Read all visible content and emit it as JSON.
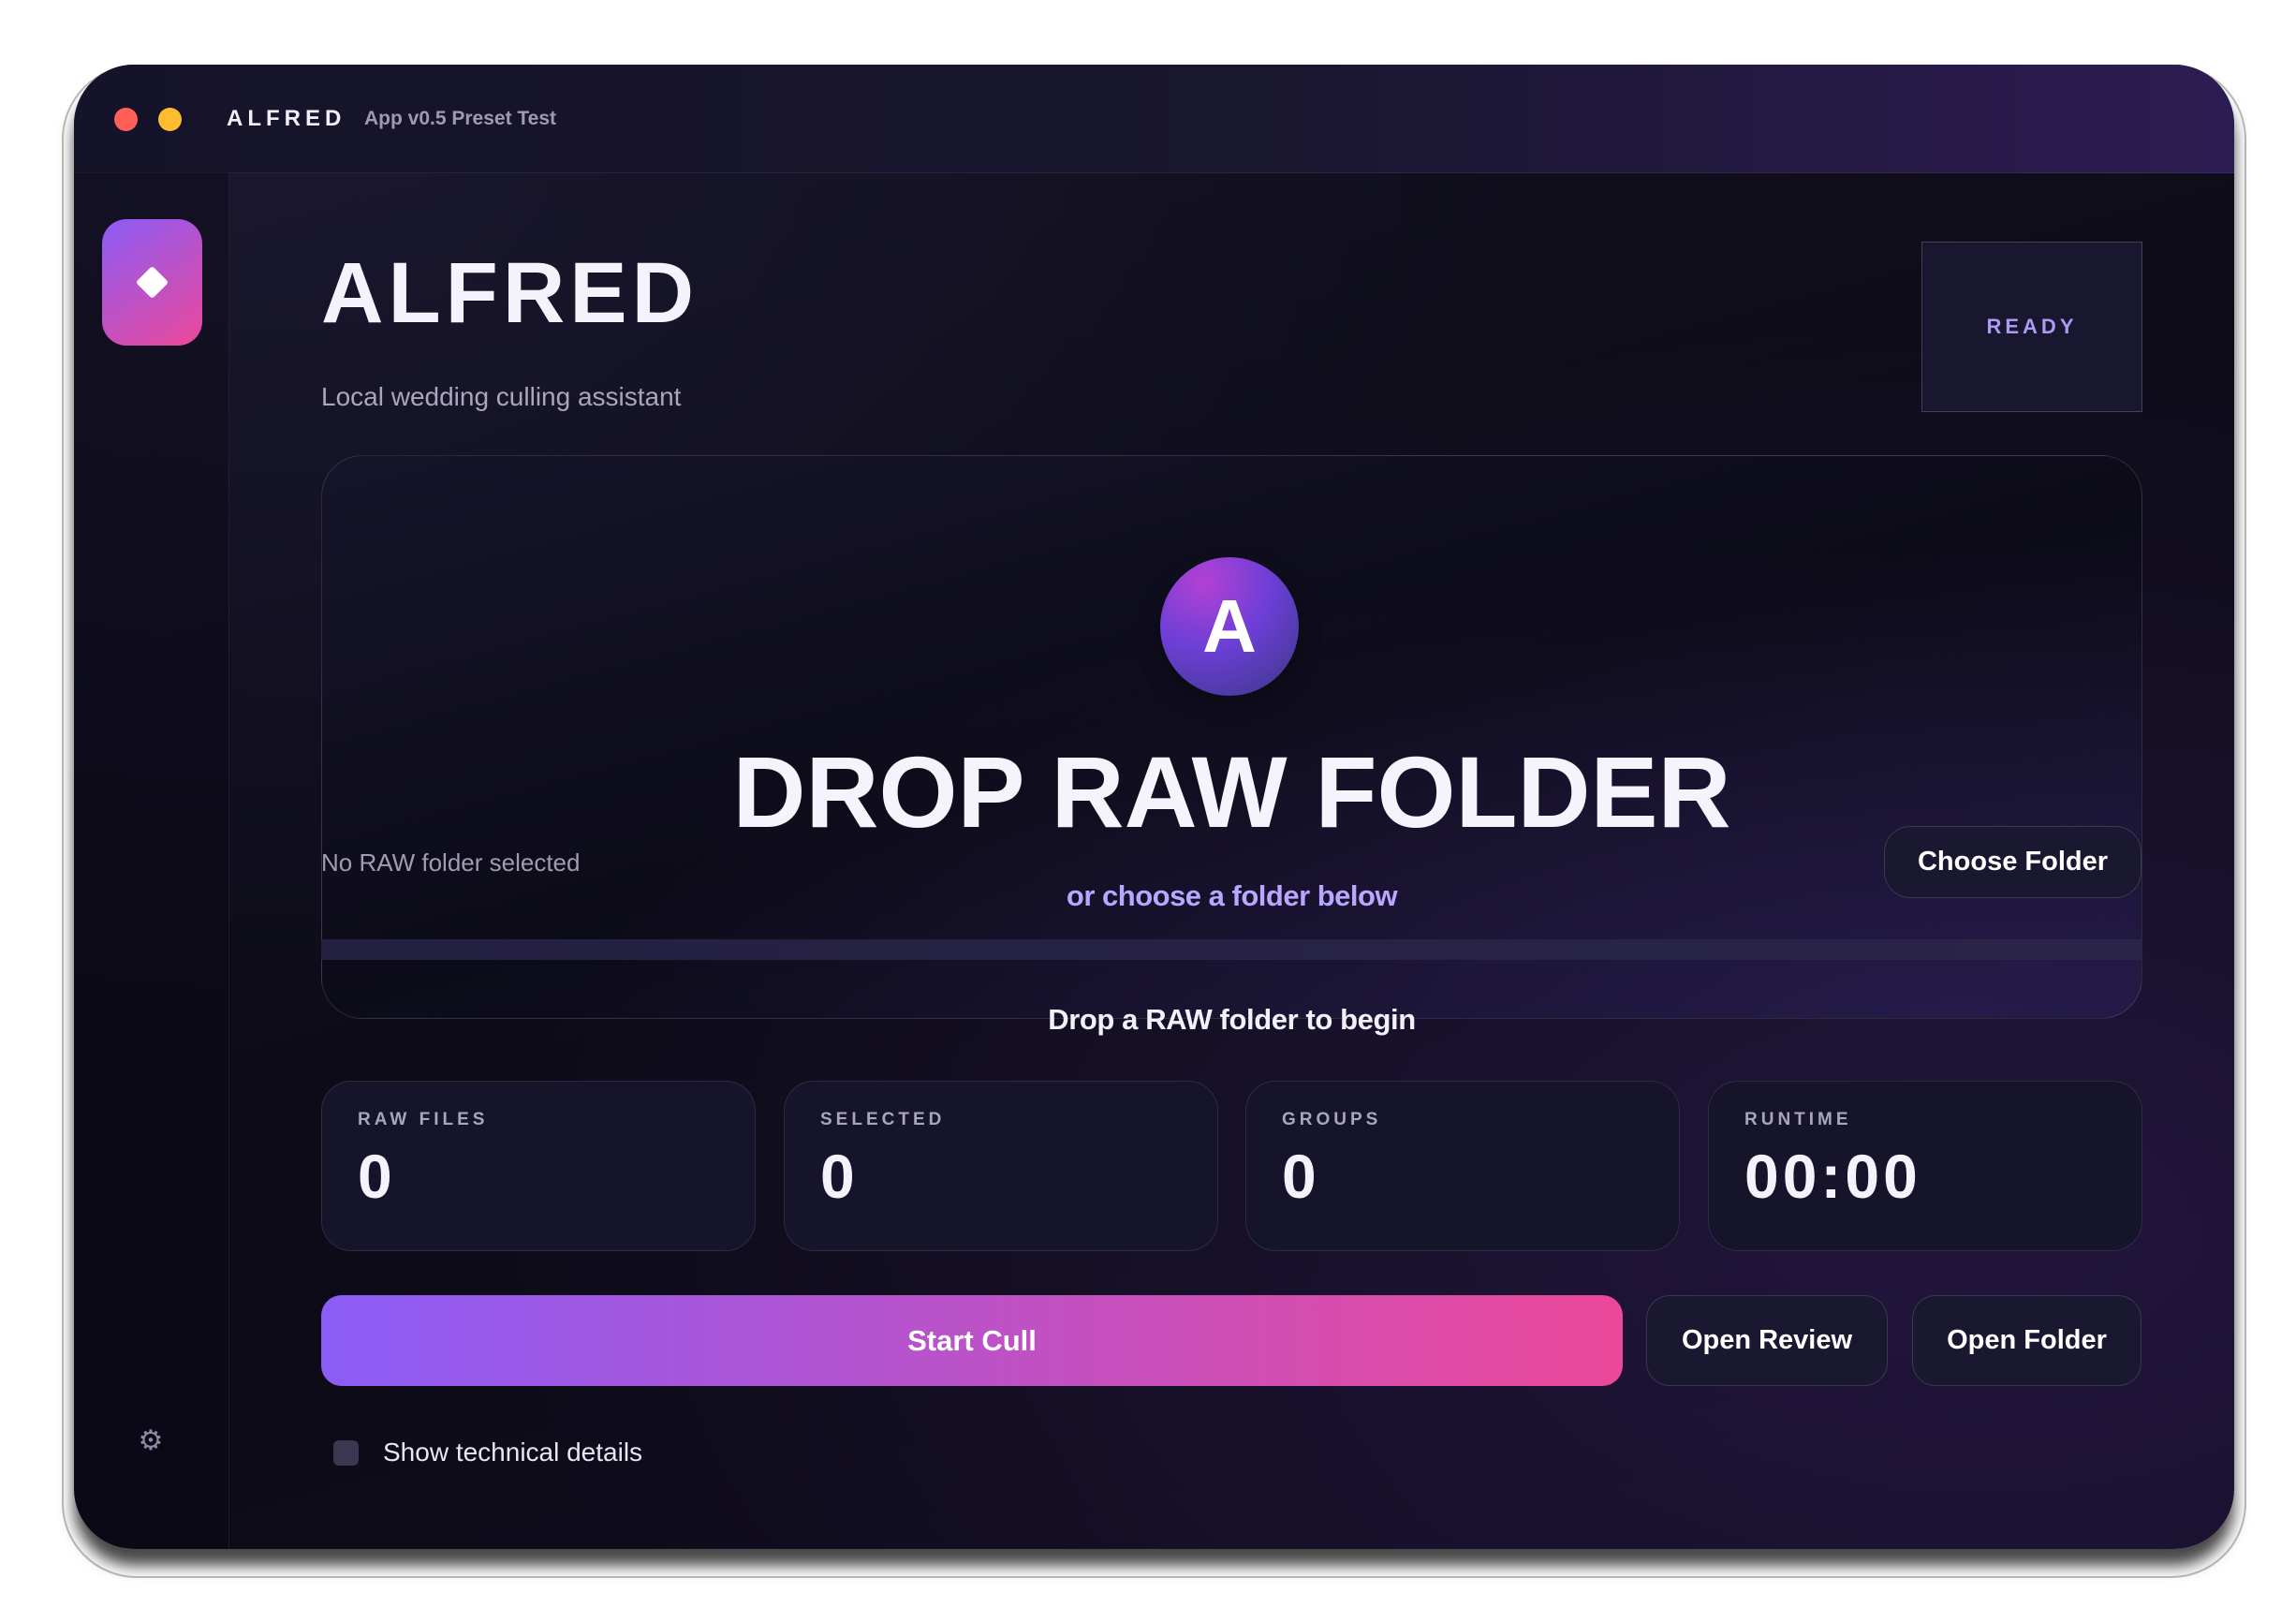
{
  "window": {
    "title": "ALFRED",
    "subtitle": "App v0.5 Preset Test"
  },
  "sidebar": {
    "logo_icon": "diamond-icon",
    "settings_icon": "gear-icon",
    "settings_glyph": "⚙"
  },
  "header": {
    "title": "ALFRED",
    "tagline": "Local wedding culling assistant",
    "status": "READY"
  },
  "dropzone": {
    "avatar_letter": "A",
    "headline": "DROP RAW FOLDER",
    "hint": "or choose a folder below",
    "folder_status": "No RAW folder selected",
    "choose_button": "Choose Folder",
    "progress": 0,
    "message": "Drop a RAW folder to begin"
  },
  "stats": [
    {
      "label": "RAW FILES",
      "value": "0"
    },
    {
      "label": "SELECTED",
      "value": "0"
    },
    {
      "label": "GROUPS",
      "value": "0"
    },
    {
      "label": "RUNTIME",
      "value": "00:00"
    }
  ],
  "actions": {
    "start": "Start Cull",
    "review": "Open Review",
    "folder": "Open Folder"
  },
  "options": {
    "technical_details": {
      "label": "Show technical details",
      "checked": false
    }
  },
  "colors": {
    "accent_start": "#8b5cf6",
    "accent_end": "#ec4899",
    "status_text": "#a99cf2",
    "hint_text": "#b9a6ff",
    "close": "#ff5f57",
    "minimize": "#febc2e"
  }
}
